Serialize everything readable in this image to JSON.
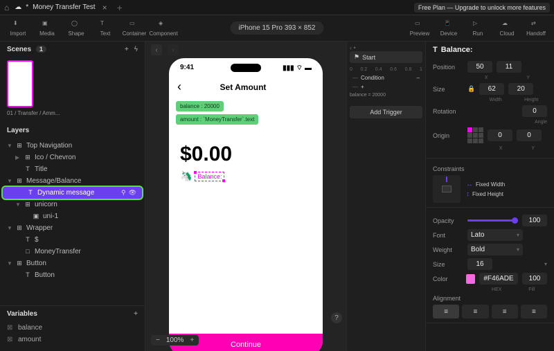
{
  "tab": {
    "title": "Money Transfer Test",
    "dirty": "*"
  },
  "upgrade_banner": "Free Plan — Upgrade to unlock more features",
  "tools": {
    "import": "Import",
    "media": "Media",
    "shape": "Shape",
    "text": "Text",
    "container": "Container",
    "component": "Component",
    "preview": "Preview",
    "device": "Device",
    "run": "Run",
    "cloud": "Cloud",
    "handoff": "Handoff"
  },
  "device_pill": "iPhone 15 Pro  393 × 852",
  "scenes": {
    "title": "Scenes",
    "count": "1",
    "thumb_label": "01 / Transfer / Amm..."
  },
  "layers": {
    "title": "Layers",
    "items": [
      {
        "label": "Top Navigation",
        "depth": 0,
        "icon": "⊞",
        "arrow": "▼"
      },
      {
        "label": "Ico / Chevron",
        "depth": 1,
        "icon": "⊞",
        "arrow": "▶"
      },
      {
        "label": "Title",
        "depth": 1,
        "icon": "T",
        "arrow": ""
      },
      {
        "label": "Message/Balance",
        "depth": 0,
        "icon": "⊞",
        "arrow": "▼"
      },
      {
        "label": "Dynamic message",
        "depth": 1,
        "icon": "T",
        "arrow": "",
        "selected": true
      },
      {
        "label": "unicorn",
        "depth": 1,
        "icon": "⊞",
        "arrow": "▼"
      },
      {
        "label": "uni-1",
        "depth": 2,
        "icon": "▣",
        "arrow": ""
      },
      {
        "label": "Wrapper",
        "depth": 0,
        "icon": "⊞",
        "arrow": "▼"
      },
      {
        "label": "$",
        "depth": 1,
        "icon": "T",
        "arrow": ""
      },
      {
        "label": "MoneyTransfer",
        "depth": 1,
        "icon": "□",
        "arrow": ""
      },
      {
        "label": "Button",
        "depth": 0,
        "icon": "⊞",
        "arrow": "▼"
      },
      {
        "label": "Button",
        "depth": 1,
        "icon": "T",
        "arrow": ""
      }
    ]
  },
  "variables": {
    "title": "Variables",
    "items": [
      "balance",
      "amount"
    ]
  },
  "canvas": {
    "zoom": "100%",
    "status_time": "9:41",
    "screen_title": "Set Amount",
    "badge1": "balance : 20000",
    "badge2": "amount : `MoneyTransfer`.text",
    "amount_display": "$0.00",
    "balance_label": "Balance:",
    "continue_label": "Continue"
  },
  "interactions": {
    "start": "Start",
    "condition": "Condition",
    "ruler": [
      "0",
      "0.2",
      "0.4",
      "0.6",
      "0.8",
      "1"
    ],
    "expr": "balance = 20000",
    "add_trigger": "Add Trigger"
  },
  "inspector": {
    "title_icon": "T",
    "title": "Balance:",
    "position": {
      "label": "Position",
      "x": "50",
      "y": "11",
      "xl": "X",
      "yl": "Y"
    },
    "size": {
      "label": "Size",
      "w": "62",
      "h": "20",
      "wl": "Width",
      "hl": "Height",
      "lock": "🔒"
    },
    "rotation": {
      "label": "Rotation",
      "v": "0",
      "sub": "Angle"
    },
    "origin": {
      "label": "Origin",
      "x": "0",
      "y": "0",
      "xl": "X",
      "yl": "Y"
    },
    "constraints": {
      "label": "Constraints",
      "fw": "Fixed Width",
      "fh": "Fixed Height"
    },
    "opacity": {
      "label": "Opacity",
      "v": "100"
    },
    "font": {
      "label": "Font",
      "v": "Lato"
    },
    "weight": {
      "label": "Weight",
      "v": "Bold"
    },
    "fsize": {
      "label": "Size",
      "v": "16"
    },
    "color": {
      "label": "Color",
      "hex": "#F46ADE",
      "fill": "100",
      "hexl": "HEX",
      "filll": "Fill"
    },
    "alignment": {
      "label": "Alignment"
    }
  }
}
